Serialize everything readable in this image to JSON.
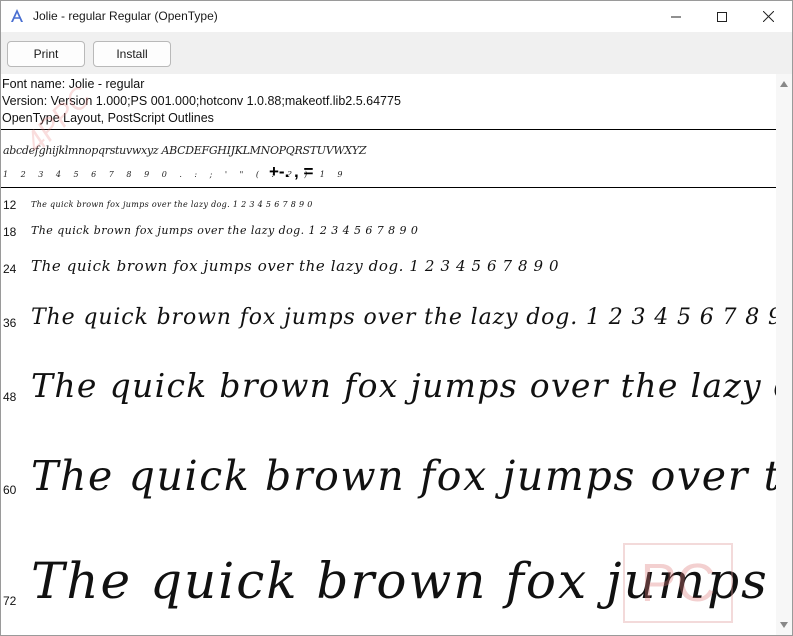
{
  "window": {
    "title": "Jolie - regular Regular (OpenType)",
    "controls": {
      "minimize": "—",
      "maximize": "☐",
      "close": "✕"
    }
  },
  "toolbar": {
    "print_label": "Print",
    "install_label": "Install"
  },
  "info": {
    "font_name": "Font name: Jolie - regular",
    "version": "Version: Version 1.000;PS 001.000;hotconv 1.0.88;makeotf.lib2.5.64775",
    "outline": "OpenType Layout, PostScript Outlines"
  },
  "charset": {
    "letters": "abcdefghijklmnopqrstuvwxyz ABCDEFGHIJKLMNOPQRSTUVWXYZ",
    "digits": "1 2 3 4 5 6 7 8 9 0 . : ; ' \" ( ! ? ) 1 9",
    "symbols": "+-. , ="
  },
  "samples": {
    "text": "The quick brown fox jumps over the lazy dog. 1 2 3 4 5 6 7 8 9 0",
    "sizes": [
      "12",
      "18",
      "24",
      "36",
      "48",
      "60",
      "72"
    ]
  },
  "watermark": {
    "label": "PC",
    "diagonal": "4PPC"
  },
  "scrollbar": {
    "up": "▲",
    "down": "▼"
  }
}
